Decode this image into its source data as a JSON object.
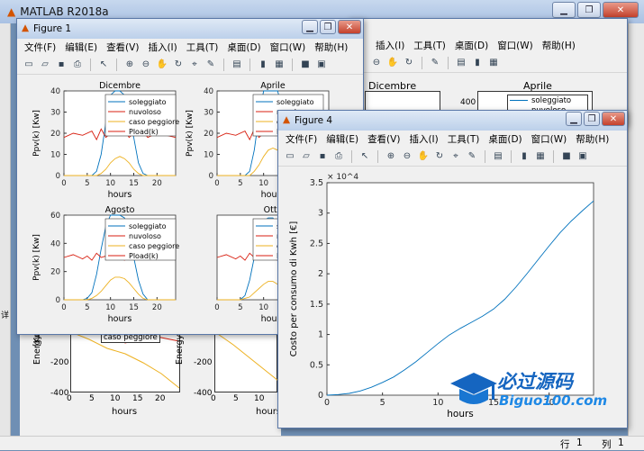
{
  "app": {
    "title": "MATLAB R2018a",
    "status_row_label": "行",
    "status_row": "1",
    "status_col_label": "列",
    "status_col": "1",
    "side_label": "详"
  },
  "menu": [
    "文件(F)",
    "编辑(E)",
    "查看(V)",
    "插入(I)",
    "工具(T)",
    "桌面(D)",
    "窗口(W)",
    "帮助(H)"
  ],
  "fig1": {
    "title": "Figure 1"
  },
  "fig4": {
    "title": "Figure 4"
  },
  "bg_fig": {
    "title_left": "Dicembre",
    "title_right": "Aprile",
    "tick_400": "400",
    "legend_1": "soleggiato",
    "legend_2": "nuvoloso"
  },
  "bottom": {
    "ylabel": "Energy",
    "ylabel_tail": "[Kw",
    "ticks": [
      "-200",
      "-400"
    ],
    "xticks": [
      "0",
      "5",
      "10",
      "15",
      "20"
    ],
    "xlabel": "hours",
    "legend_peek": "caso peggiore"
  },
  "legend": {
    "items": [
      "soleggiato",
      "nuvoloso",
      "caso peggiore",
      "Pload(k)"
    ],
    "colors": [
      "#0072bd",
      "#d81f10",
      "#edb120",
      "#d81f10"
    ]
  },
  "watermark": {
    "brand": "必过源码",
    "site": "Biguo100.com"
  },
  "chart_data": [
    {
      "type": "line",
      "title": "Dicembre",
      "xlabel": "hours",
      "ylabel": "Ppv(k) [Kw]",
      "ylim": [
        0,
        40
      ],
      "yticks": [
        0,
        10,
        20,
        30,
        40
      ],
      "xlim": [
        0,
        24
      ],
      "xticks": [
        0,
        5,
        10,
        15,
        20
      ],
      "x": [
        0,
        2,
        4,
        6,
        7,
        8,
        9,
        10,
        11,
        12,
        13,
        14,
        15,
        16,
        17,
        18,
        20,
        22,
        24
      ],
      "series": [
        {
          "name": "soleggiato",
          "values": [
            0,
            0,
            0,
            0,
            2,
            10,
            25,
            38,
            40,
            40,
            38,
            30,
            18,
            6,
            1,
            0,
            0,
            0,
            0
          ]
        },
        {
          "name": "nuvoloso",
          "values": [
            18,
            20,
            19,
            21,
            17,
            22,
            18,
            20,
            21,
            19,
            22,
            18,
            20,
            19,
            21,
            18,
            20,
            19,
            18
          ]
        },
        {
          "name": "caso peggiore",
          "values": [
            0,
            0,
            0,
            0,
            0,
            1,
            3,
            6,
            8,
            9,
            8,
            6,
            3,
            1,
            0,
            0,
            0,
            0,
            0
          ]
        }
      ]
    },
    {
      "type": "line",
      "title": "Aprile",
      "xlabel": "hours",
      "ylabel": "Ppv(k) [Kw]",
      "ylim": [
        0,
        40
      ],
      "yticks": [
        0,
        10,
        20,
        30,
        40
      ],
      "xlim": [
        0,
        24
      ],
      "xticks": [
        0,
        5,
        10,
        15,
        20
      ],
      "x": [
        0,
        2,
        4,
        6,
        7,
        8,
        9,
        10,
        11,
        12,
        13,
        14,
        15,
        16,
        17,
        18,
        20,
        22,
        24
      ],
      "series": [
        {
          "name": "soleggiato",
          "values": [
            0,
            0,
            0,
            0,
            2,
            12,
            28,
            40,
            40,
            40,
            40,
            32,
            20,
            8,
            1,
            0,
            0,
            0,
            0
          ]
        },
        {
          "name": "nuvoloso",
          "values": [
            18,
            20,
            19,
            21,
            17,
            22,
            18,
            20,
            21,
            19,
            22,
            18,
            20,
            19,
            21,
            18,
            20,
            19,
            18
          ]
        },
        {
          "name": "caso peggiore",
          "values": [
            0,
            0,
            0,
            0,
            0,
            2,
            5,
            9,
            12,
            13,
            12,
            9,
            5,
            2,
            0,
            0,
            0,
            0,
            0
          ]
        }
      ]
    },
    {
      "type": "line",
      "title": "Agosto",
      "xlabel": "hours",
      "ylabel": "Ppv(k) [Kw]",
      "ylim": [
        0,
        60
      ],
      "yticks": [
        0,
        20,
        40,
        60
      ],
      "xlim": [
        0,
        24
      ],
      "xticks": [
        0,
        5,
        10,
        15,
        20
      ],
      "x": [
        0,
        2,
        4,
        5,
        6,
        7,
        8,
        9,
        10,
        11,
        12,
        13,
        14,
        15,
        16,
        17,
        18,
        20,
        22,
        24
      ],
      "series": [
        {
          "name": "soleggiato",
          "values": [
            0,
            0,
            0,
            1,
            5,
            18,
            36,
            52,
            60,
            60,
            60,
            58,
            46,
            30,
            14,
            4,
            0,
            0,
            0,
            0
          ]
        },
        {
          "name": "nuvoloso",
          "values": [
            30,
            32,
            29,
            31,
            28,
            33,
            30,
            31,
            29,
            32,
            30,
            28,
            31,
            30,
            32,
            29,
            31,
            30,
            31,
            30
          ]
        },
        {
          "name": "caso peggiore",
          "values": [
            0,
            0,
            0,
            0,
            1,
            3,
            6,
            10,
            14,
            16,
            16,
            15,
            12,
            8,
            4,
            1,
            0,
            0,
            0,
            0
          ]
        }
      ]
    },
    {
      "type": "line",
      "title": "Otto",
      "xlabel": "hours",
      "ylabel": "",
      "ylim": [
        0,
        60
      ],
      "xlim": [
        0,
        24
      ],
      "xticks": [
        0,
        5,
        10,
        15,
        20
      ],
      "x": [
        0,
        2,
        4,
        5,
        6,
        7,
        8,
        9,
        10,
        11,
        12,
        13,
        14,
        15,
        16,
        17,
        18,
        20,
        22,
        24
      ],
      "series": [
        {
          "name": "soleggiato",
          "values": [
            0,
            0,
            0,
            0,
            3,
            14,
            30,
            46,
            56,
            58,
            58,
            52,
            40,
            24,
            10,
            2,
            0,
            0,
            0,
            0
          ]
        },
        {
          "name": "nuvoloso",
          "values": [
            30,
            32,
            29,
            31,
            28,
            33,
            30,
            31,
            29,
            32,
            30,
            28,
            31,
            30,
            32,
            29,
            31,
            30,
            31,
            30
          ]
        },
        {
          "name": "caso peggiore",
          "values": [
            0,
            0,
            0,
            0,
            1,
            2,
            5,
            8,
            11,
            13,
            13,
            11,
            8,
            5,
            2,
            1,
            0,
            0,
            0,
            0
          ]
        }
      ]
    },
    {
      "type": "line",
      "title": "",
      "xlabel": "hours",
      "ylabel": "Costo per consumo di Kwh [€]",
      "ylim": [
        0,
        35000
      ],
      "yticks": [
        0,
        0.5,
        1,
        1.5,
        2,
        2.5,
        3,
        3.5
      ],
      "yexp": "× 10^4",
      "xlim": [
        0,
        24
      ],
      "xticks": [
        0,
        5,
        10,
        15,
        20
      ],
      "x": [
        0,
        1,
        2,
        3,
        4,
        5,
        6,
        7,
        8,
        9,
        10,
        11,
        12,
        13,
        14,
        15,
        16,
        17,
        18,
        19,
        20,
        21,
        22,
        23,
        24
      ],
      "series": [
        {
          "name": "",
          "values": [
            0,
            100,
            300,
            700,
            1300,
            2100,
            3000,
            4200,
            5500,
            7000,
            8500,
            9900,
            11000,
            12000,
            13000,
            14200,
            15800,
            17800,
            20000,
            22300,
            24600,
            26800,
            28700,
            30400,
            32000
          ]
        }
      ]
    }
  ]
}
